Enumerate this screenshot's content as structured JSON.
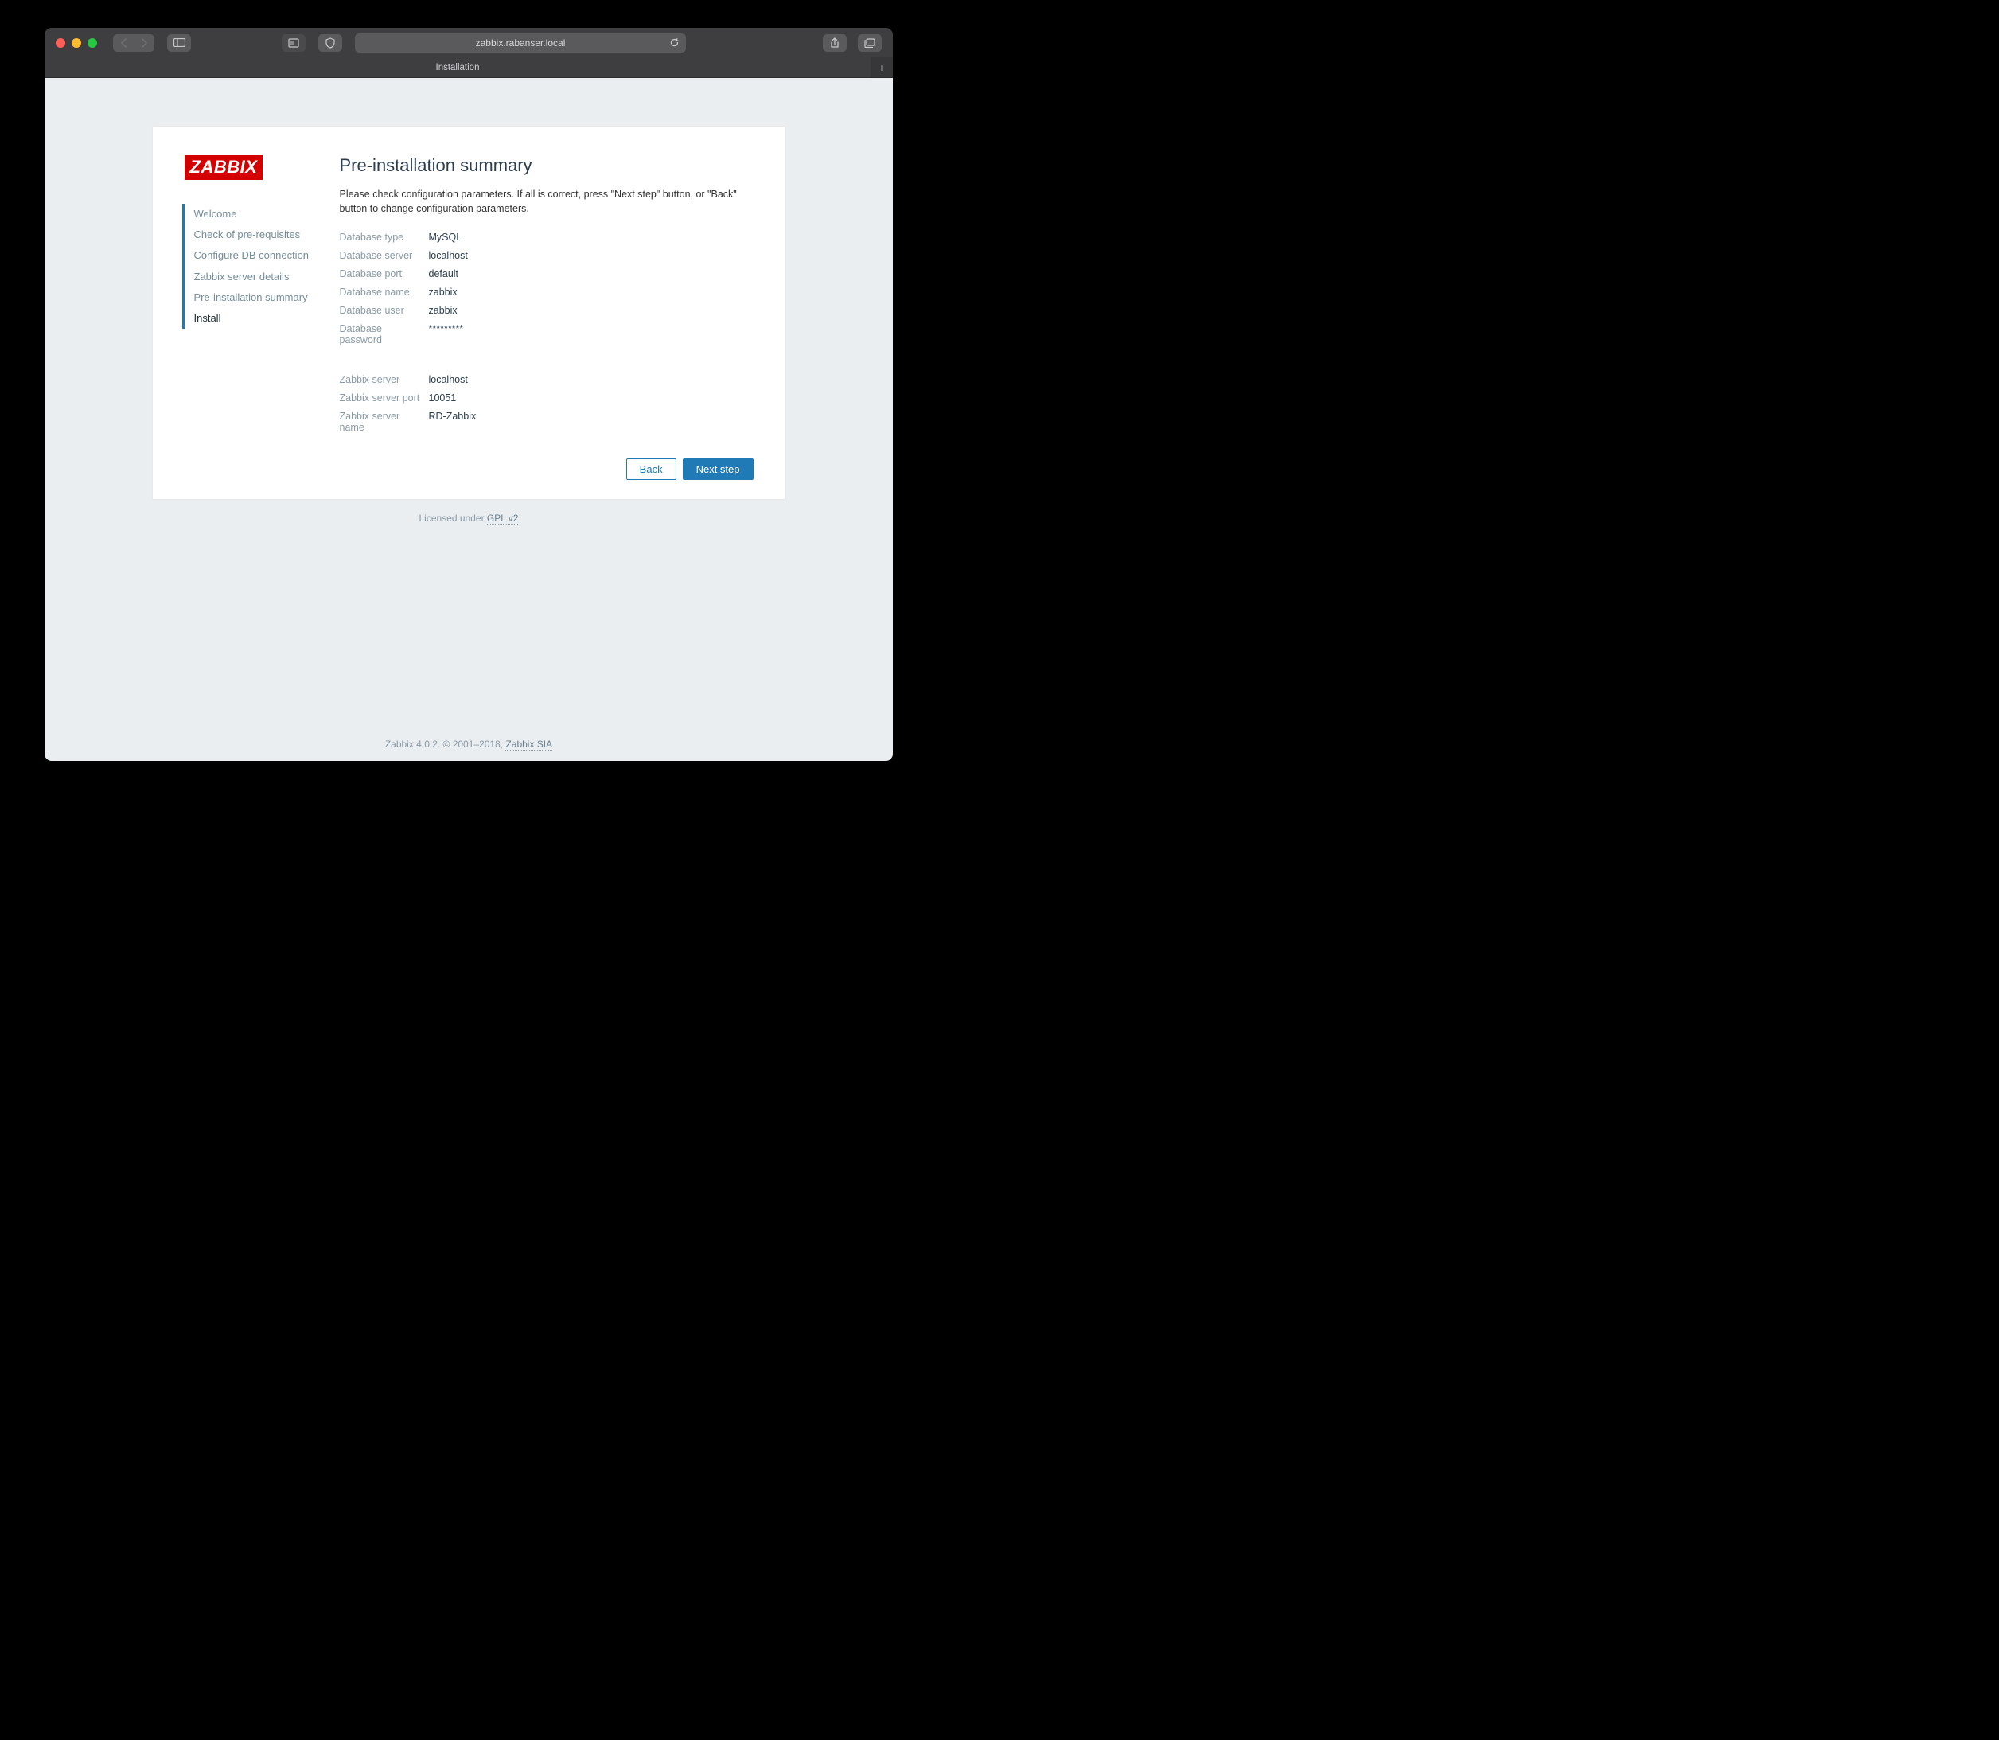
{
  "browser": {
    "address": "zabbix.rabanser.local",
    "tab_title": "Installation"
  },
  "logo": "ZABBIX",
  "steps": [
    "Welcome",
    "Check of pre-requisites",
    "Configure DB connection",
    "Zabbix server details",
    "Pre-installation summary",
    "Install"
  ],
  "main": {
    "title": "Pre-installation summary",
    "description": "Please check configuration parameters. If all is correct, press \"Next step\" button, or \"Back\" button to change configuration parameters."
  },
  "params": {
    "db_type_label": "Database type",
    "db_type_value": "MySQL",
    "db_server_label": "Database server",
    "db_server_value": "localhost",
    "db_port_label": "Database port",
    "db_port_value": "default",
    "db_name_label": "Database name",
    "db_name_value": "zabbix",
    "db_user_label": "Database user",
    "db_user_value": "zabbix",
    "db_password_label": "Database password",
    "db_password_value": "*********",
    "zs_label": "Zabbix server",
    "zs_value": "localhost",
    "zs_port_label": "Zabbix server port",
    "zs_port_value": "10051",
    "zs_name_label": "Zabbix server name",
    "zs_name_value": "RD-Zabbix"
  },
  "buttons": {
    "back": "Back",
    "next": "Next step"
  },
  "footer": {
    "licensed_prefix": "Licensed under ",
    "license_link": "GPL v2",
    "bottom_prefix": "Zabbix 4.0.2. © 2001–2018, ",
    "bottom_link": "Zabbix SIA"
  }
}
